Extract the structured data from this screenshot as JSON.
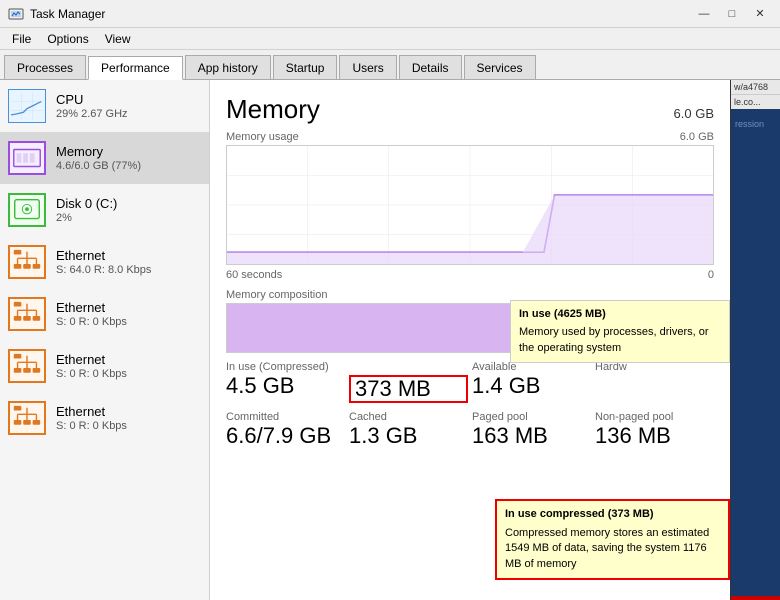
{
  "titleBar": {
    "title": "Task Manager",
    "minimize": "—",
    "maximize": "□",
    "close": "✕"
  },
  "menuBar": {
    "items": [
      "File",
      "Options",
      "View"
    ]
  },
  "tabs": [
    {
      "label": "Processes",
      "active": false
    },
    {
      "label": "Performance",
      "active": true
    },
    {
      "label": "App history",
      "active": false
    },
    {
      "label": "Startup",
      "active": false
    },
    {
      "label": "Users",
      "active": false
    },
    {
      "label": "Details",
      "active": false
    },
    {
      "label": "Services",
      "active": false
    }
  ],
  "sidebar": {
    "items": [
      {
        "name": "CPU",
        "sub": "29% 2.67 GHz",
        "type": "cpu",
        "active": false
      },
      {
        "name": "Memory",
        "sub": "4.6/6.0 GB (77%)",
        "type": "memory",
        "active": true
      },
      {
        "name": "Disk 0 (C:)",
        "sub": "2%",
        "type": "disk",
        "active": false
      },
      {
        "name": "Ethernet",
        "sub": "S: 64.0  R: 8.0 Kbps",
        "type": "ethernet",
        "active": false
      },
      {
        "name": "Ethernet",
        "sub": "S: 0  R: 0 Kbps",
        "type": "ethernet",
        "active": false
      },
      {
        "name": "Ethernet",
        "sub": "S: 0  R: 0 Kbps",
        "type": "ethernet",
        "active": false
      },
      {
        "name": "Ethernet",
        "sub": "S: 0  R: 0 Kbps",
        "type": "ethernet",
        "active": false
      }
    ]
  },
  "content": {
    "title": "Memory",
    "totalRam": "6.0 GB",
    "usageChartLabel": "Memory usage",
    "usageChartMax": "6.0 GB",
    "timeStart": "60 seconds",
    "timeEnd": "0",
    "compositionLabel": "Memory composition",
    "stats": {
      "inUseLabel": "In use (Compressed)",
      "inUseValue": "4.5 GB",
      "compressedLabel": "",
      "compressedValue": "373 MB",
      "availableLabel": "Available",
      "availableValue": "1.4 GB",
      "hardwareLabel": "Hardw",
      "committedLabel": "Committed",
      "committedValue": "6.6/7.9 GB",
      "cachedLabel": "Cached",
      "cachedValue": "1.3 GB",
      "pagedPoolLabel": "Paged pool",
      "pagedPoolValue": "163 MB",
      "nonPagedPoolLabel": "Non-paged pool",
      "nonPagedPoolValue": "136 MB"
    },
    "tooltip1": {
      "title": "In use (4625 MB)",
      "body": "Memory used by processes, drivers, or the operating system"
    },
    "tooltip2": {
      "title": "In use compressed (373 MB)",
      "body": "Compressed memory stores an estimated 1549 MB of data, saving the system 1176 MB of memory"
    }
  },
  "browserSnippet": {
    "urlLine1": "w/a4768",
    "urlLine2": "le.co..."
  }
}
